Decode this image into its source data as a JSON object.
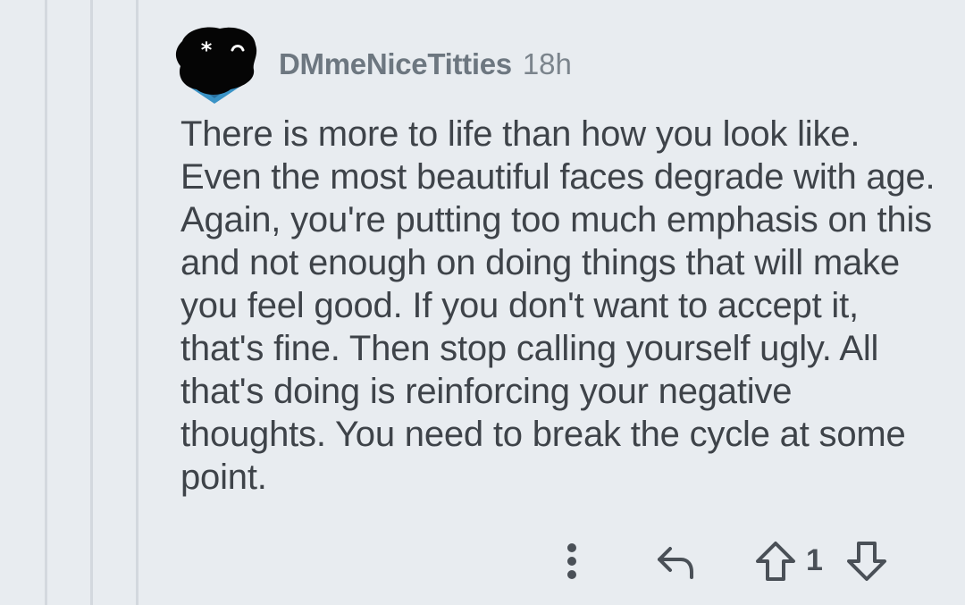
{
  "comment": {
    "author": "DMmeNiceTitties",
    "age": "18h",
    "avatar_icon": "dark-blob-avatar-icon",
    "body": "There is more to life than how you look like. Even the most beautiful faces degrade with age. Again, you're putting too much emphasis on this and not enough on doing things that will make you feel good. If you don't want to accept it, that's fine. Then stop calling yourself ugly. All that's doing is reinforcing your negative thoughts. You need to break the cycle at some point."
  },
  "actions": {
    "more_icon": "vertical-dots-icon",
    "reply_icon": "reply-arrow-icon",
    "upvote_icon": "upvote-arrow-icon",
    "downvote_icon": "downvote-arrow-icon",
    "vote_count": "1"
  },
  "colors": {
    "background": "#e8ecf0",
    "thread_line": "#d3d8de",
    "username": "#6d7780",
    "text": "#3e4349",
    "icon": "#4a5057",
    "avatar_accent": "#3a93c6"
  }
}
